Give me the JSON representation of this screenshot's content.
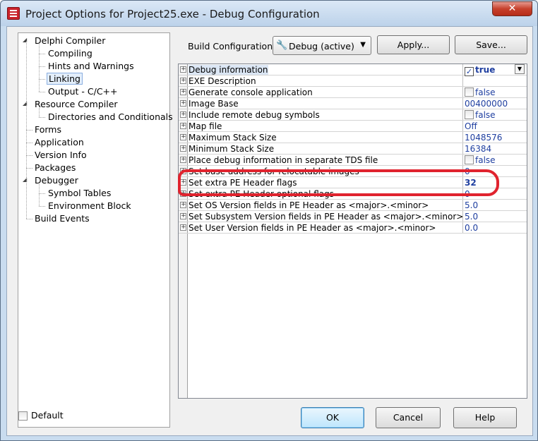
{
  "window": {
    "title": "Project Options for Project25.exe - Debug Configuration",
    "close_glyph": "✕"
  },
  "tree": {
    "items": [
      {
        "label": "Delphi Compiler",
        "level": 0,
        "expander": "◢"
      },
      {
        "label": "Compiling",
        "level": 1
      },
      {
        "label": "Hints and Warnings",
        "level": 1
      },
      {
        "label": "Linking",
        "level": 1,
        "selected": true
      },
      {
        "label": "Output - C/C++",
        "level": 1
      },
      {
        "label": "Resource Compiler",
        "level": 0,
        "expander": "◢"
      },
      {
        "label": "Directories and Conditionals",
        "level": 1
      },
      {
        "label": "Forms",
        "level": 0
      },
      {
        "label": "Application",
        "level": 0
      },
      {
        "label": "Version Info",
        "level": 0
      },
      {
        "label": "Packages",
        "level": 0
      },
      {
        "label": "Debugger",
        "level": 0,
        "expander": "◢"
      },
      {
        "label": "Symbol Tables",
        "level": 1
      },
      {
        "label": "Environment Block",
        "level": 1
      },
      {
        "label": "Build Events",
        "level": 0
      }
    ]
  },
  "default_checkbox": {
    "label": "Default",
    "checked": false
  },
  "build": {
    "label": "Build Configuration:",
    "selected": "Debug (active)",
    "icon": "wrench-icon",
    "apply_label": "Apply...",
    "save_label": "Save..."
  },
  "properties": [
    {
      "name": "Debug information",
      "value": "true",
      "checkbox": true,
      "checked": true,
      "selected": true,
      "combo": true
    },
    {
      "name": "EXE Description",
      "value": ""
    },
    {
      "name": "Generate console application",
      "value": "false",
      "checkbox": true,
      "checked": false
    },
    {
      "name": "Image Base",
      "value": "00400000"
    },
    {
      "name": "Include remote debug symbols",
      "value": "false",
      "checkbox": true,
      "checked": false
    },
    {
      "name": "Map file",
      "value": "Off"
    },
    {
      "name": "Maximum Stack Size",
      "value": "1048576"
    },
    {
      "name": "Minimum Stack Size",
      "value": "16384"
    },
    {
      "name": "Place debug information in separate TDS file",
      "value": "false",
      "checkbox": true,
      "checked": false
    },
    {
      "name": "Set base address for relocatable images",
      "value": "0"
    },
    {
      "name": "Set extra PE Header flags",
      "value": "32",
      "bold": true
    },
    {
      "name": "Set extra PE Header optional flags",
      "value": "0"
    },
    {
      "name": "Set OS Version fields in PE Header as <major>.<minor>",
      "value": "5.0"
    },
    {
      "name": "Set Subsystem Version fields in PE Header as <major>.<minor>",
      "value": "5.0"
    },
    {
      "name": "Set User Version fields in PE Header as <major>.<minor>",
      "value": "0.0"
    }
  ],
  "buttons": {
    "ok": "OK",
    "cancel": "Cancel",
    "help": "Help"
  },
  "colors": {
    "highlight_ring": "#e0232e",
    "value_text": "#1f3fa0"
  }
}
